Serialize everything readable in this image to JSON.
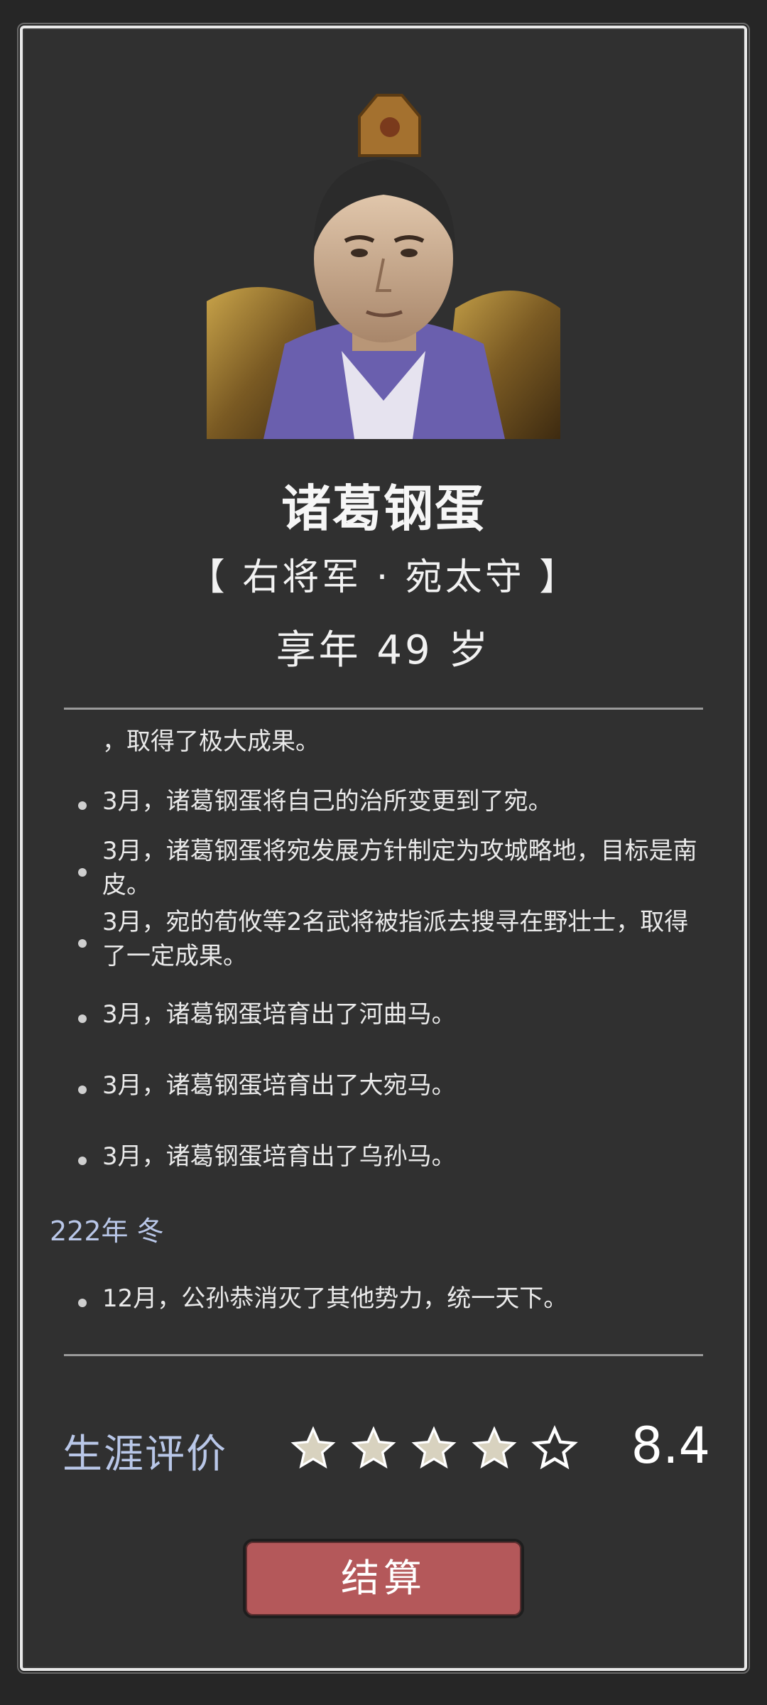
{
  "character": {
    "name": "诸葛钢蛋",
    "title": "【 右将军 · 宛太守 】",
    "age": "享年 49 岁"
  },
  "log": {
    "items": [
      {
        "text": "，取得了极大成果。",
        "bullet": false
      },
      {
        "text": "3月，诸葛钢蛋将自己的治所变更到了宛。",
        "bullet": true
      },
      {
        "text": "3月，诸葛钢蛋将宛发展方针制定为攻城略地，目标是南皮。",
        "bullet": true
      },
      {
        "text": "3月，宛的荀攸等2名武将被指派去搜寻在野壮士，取得了一定成果。",
        "bullet": true
      },
      {
        "text": "3月，诸葛钢蛋培育出了河曲马。",
        "bullet": true
      },
      {
        "text": "3月，诸葛钢蛋培育出了大宛马。",
        "bullet": true
      },
      {
        "text": "3月，诸葛钢蛋培育出了乌孙马。",
        "bullet": true
      }
    ],
    "season_header": "222年 冬",
    "season_items": [
      {
        "text": "12月，公孙恭消灭了其他势力，统一天下。",
        "bullet": true
      }
    ]
  },
  "rating": {
    "label": "生涯评价",
    "score": "8.4",
    "stars": [
      1,
      1,
      1,
      1,
      0
    ]
  },
  "button": {
    "label": "结算"
  }
}
